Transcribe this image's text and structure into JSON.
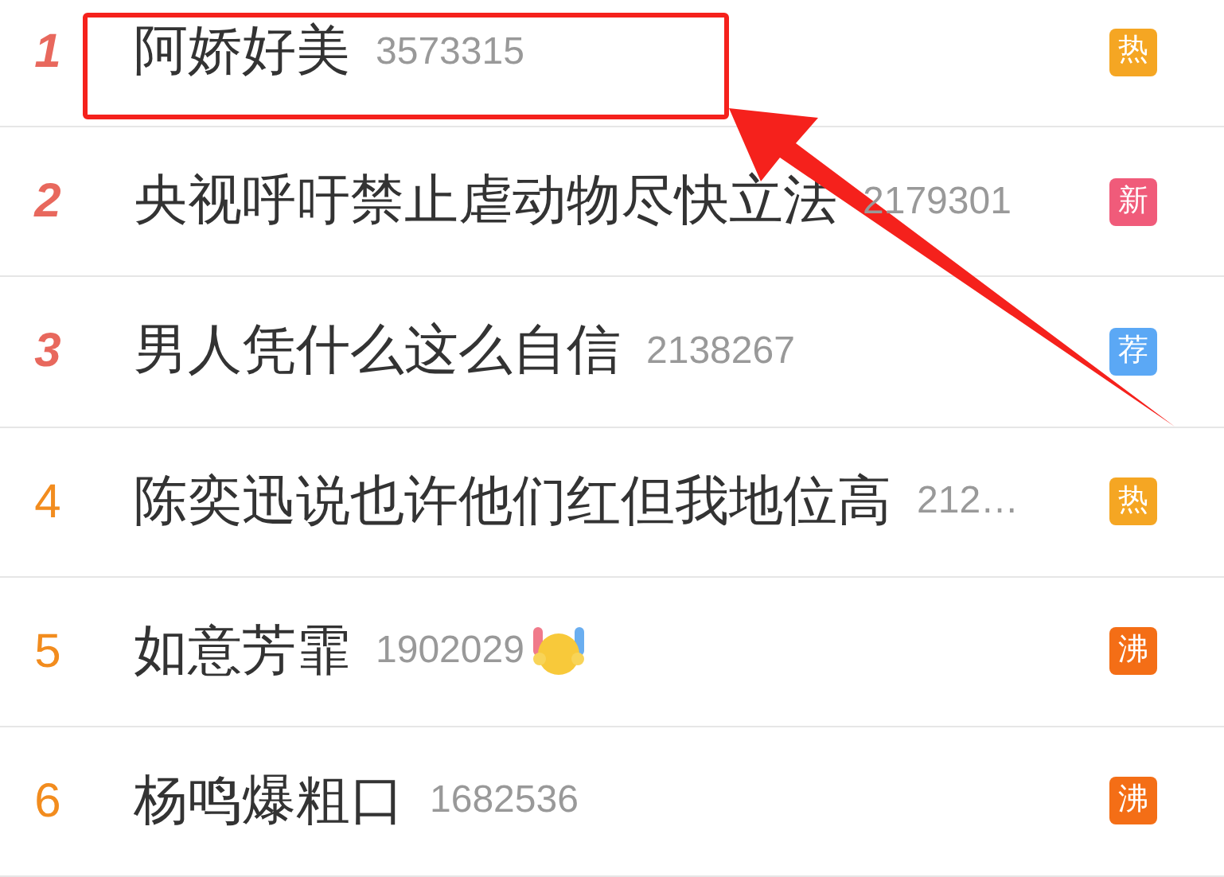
{
  "hot_list": [
    {
      "rank": "1",
      "top": true,
      "title": "阿娇好美",
      "count": "3573315",
      "emoji": false,
      "badge": "热",
      "color": "#f5a623",
      "highlighted": true
    },
    {
      "rank": "2",
      "top": true,
      "title": "央视呼吁禁止虐动物尽快立法",
      "count": "2179301",
      "emoji": false,
      "badge": "新",
      "color": "#f05b7a",
      "highlighted": false
    },
    {
      "rank": "3",
      "top": true,
      "title": "男人凭什么这么自信",
      "count": "2138267",
      "emoji": false,
      "badge": "荐",
      "color": "#5ba8f5",
      "highlighted": false
    },
    {
      "rank": "4",
      "top": false,
      "title": "陈奕迅说也许他们红但我地位高",
      "count": "212…",
      "emoji": false,
      "badge": "热",
      "color": "#f5a623",
      "highlighted": false
    },
    {
      "rank": "5",
      "top": false,
      "title": "如意芳霏",
      "count": "1902029",
      "emoji": true,
      "badge": "沸",
      "color": "#f46e16",
      "highlighted": false
    },
    {
      "rank": "6",
      "top": false,
      "title": "杨鸣爆粗口",
      "count": "1682536",
      "emoji": false,
      "badge": "沸",
      "color": "#f46e16",
      "highlighted": false
    }
  ]
}
